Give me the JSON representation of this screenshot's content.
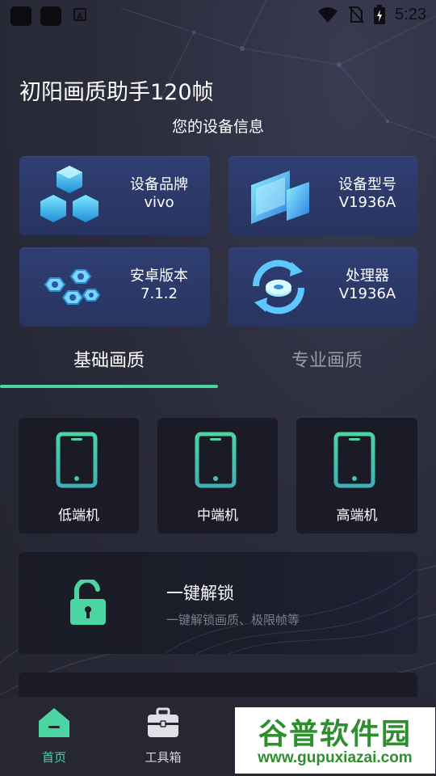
{
  "status_bar": {
    "time": "5:23",
    "icons": [
      "notification-square-icon",
      "notification-square-icon",
      "android-a-icon",
      "wifi-icon",
      "no-sim-icon",
      "battery-charging-icon"
    ]
  },
  "app": {
    "title": "初阳画质助手120帧"
  },
  "device_info": {
    "section_title": "您的设备信息",
    "cards": [
      {
        "label": "设备品牌",
        "value": "vivo",
        "icon": "cubes-icon"
      },
      {
        "label": "设备型号",
        "value": "V1936A",
        "icon": "screens-icon"
      },
      {
        "label": "安卓版本",
        "value": "7.1.2",
        "icon": "nuts-icon"
      },
      {
        "label": "处理器",
        "value": "V1936A",
        "icon": "refresh-chip-icon"
      }
    ]
  },
  "tabs": [
    {
      "label": "基础画质",
      "active": true
    },
    {
      "label": "专业画质",
      "active": false
    }
  ],
  "tiers": [
    {
      "label": "低端机",
      "icon": "phone-icon"
    },
    {
      "label": "中端机",
      "icon": "phone-icon"
    },
    {
      "label": "高端机",
      "icon": "phone-icon"
    }
  ],
  "unlock": {
    "title": "一键解锁",
    "subtitle": "一键解锁画质、极限帧等",
    "icon": "unlock-padlock-icon"
  },
  "bottom_nav": [
    {
      "label": "首页",
      "icon": "home-icon",
      "active": true
    },
    {
      "label": "工具箱",
      "icon": "toolbox-icon",
      "active": false
    }
  ],
  "watermark": {
    "title": "谷普软件园",
    "url": "www.gupuxiazai.com"
  },
  "colors": {
    "accent": "#4bd5a3",
    "card_blue": "#2f3f73",
    "card_dark": "#1a1b26",
    "background": "#2b2c3c"
  }
}
